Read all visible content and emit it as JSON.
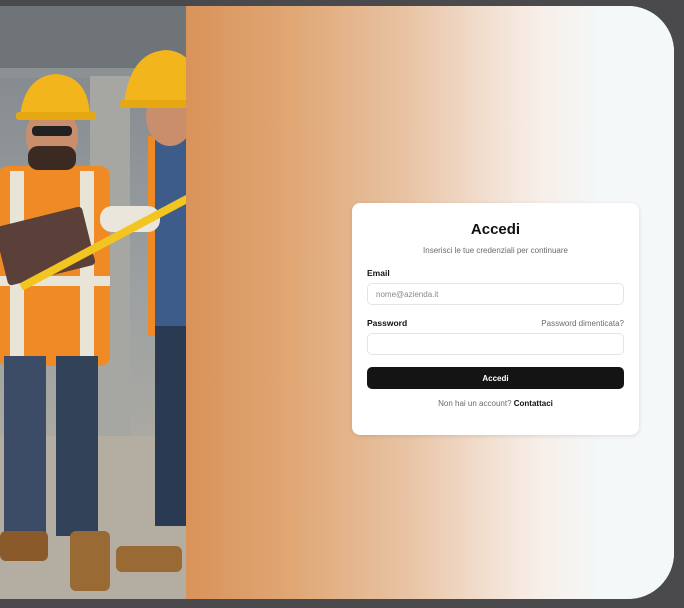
{
  "login": {
    "title": "Accedi",
    "subtitle": "Inserisci le tue credenziali per continuare",
    "email_label": "Email",
    "email_placeholder": "nome@azienda.it",
    "email_value": "",
    "password_label": "Password",
    "forgot_link": "Password dimenticata?",
    "password_value": "",
    "submit_label": "Accedi",
    "signup_prompt": "Non hai un account?",
    "signup_link": "Contattaci"
  },
  "colors": {
    "accent_gradient_start": "#d9935a",
    "background": "#f4f8f9",
    "button": "#141414",
    "hardhat": "#f2b51c",
    "safety_vest": "#f08a24"
  },
  "hero_image": {
    "subject": "construction-workers-with-hardhats"
  }
}
